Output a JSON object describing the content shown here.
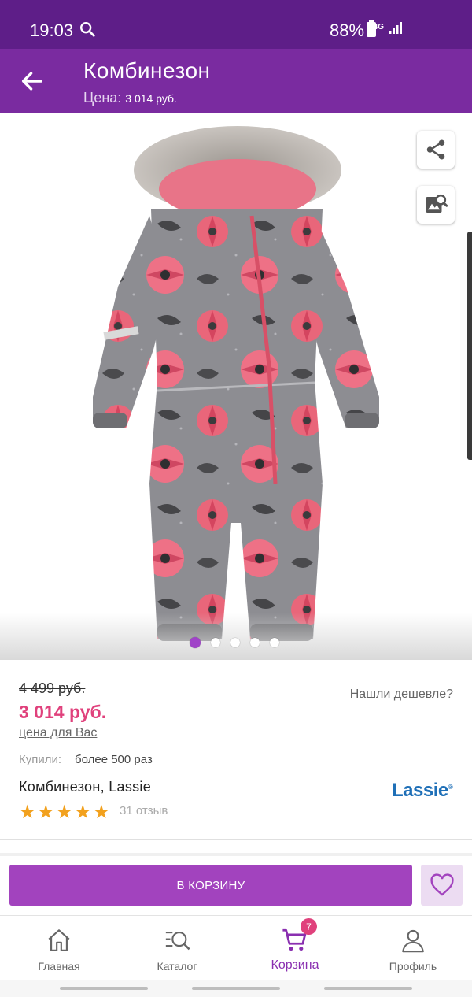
{
  "status_bar": {
    "time": "19:03",
    "network": "4G",
    "battery": "88%"
  },
  "app_bar": {
    "title": "Комбинезон",
    "price_label": "Цена:",
    "price_value": "3 014 руб."
  },
  "gallery": {
    "image_alt": "Комбинезон",
    "total_images": 5,
    "active_index": 0
  },
  "product": {
    "old_price": "4 499 руб.",
    "found_cheaper": "Нашли дешевле?",
    "price": "3 014 руб.",
    "price_note": "цена для Вас",
    "bought_label": "Купили:",
    "bought_value": "более 500 раз",
    "name": "Комбинезон, Lassie",
    "brand": "Lassie",
    "rating": 5,
    "reviews": "31 отзыв"
  },
  "actions": {
    "add_to_cart": "В КОРЗИНУ"
  },
  "bottom_nav": {
    "items": [
      {
        "label": "Главная",
        "icon": "home-icon"
      },
      {
        "label": "Каталог",
        "icon": "catalog-search-icon"
      },
      {
        "label": "Корзина",
        "icon": "cart-icon",
        "active": true,
        "badge": "7"
      },
      {
        "label": "Профиль",
        "icon": "profile-icon"
      }
    ]
  },
  "colors": {
    "status_bar": "#5e1e88",
    "app_bar": "#7a2ba0",
    "accent": "#a243be",
    "price": "#e0417c",
    "star": "#f2a11e",
    "brand": "#1e6fb7"
  }
}
